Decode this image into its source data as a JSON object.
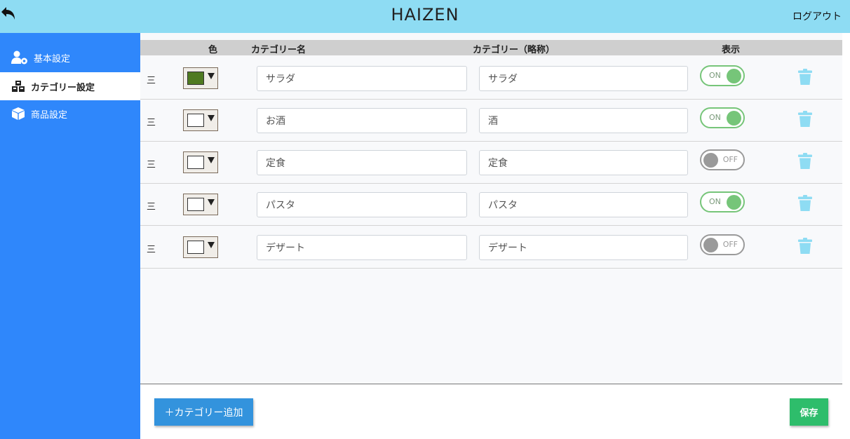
{
  "header": {
    "title": "HAIZEN",
    "logout_label": "ログアウト",
    "back_icon": "back-arrow-icon"
  },
  "sidebar": {
    "items": [
      {
        "label": "基本設定",
        "icon": "user-gear-icon",
        "active": false
      },
      {
        "label": "カテゴリー設定",
        "icon": "cubes-icon",
        "active": true
      },
      {
        "label": "商品設定",
        "icon": "box-icon",
        "active": false
      }
    ]
  },
  "table": {
    "headers": {
      "color": "色",
      "name": "カテゴリー名",
      "abbr": "カテゴリー（略称）",
      "display": "表示"
    },
    "rows": [
      {
        "handle": "三",
        "color": "#4f7a21",
        "name": "サラダ",
        "abbr": "サラダ",
        "display": "ON"
      },
      {
        "handle": "三",
        "color": "#ffffff",
        "name": "お酒",
        "abbr": "酒",
        "display": "ON"
      },
      {
        "handle": "三",
        "color": "#ffffff",
        "name": "定食",
        "abbr": "定食",
        "display": "OFF"
      },
      {
        "handle": "三",
        "color": "#ffffff",
        "name": "パスタ",
        "abbr": "パスタ",
        "display": "ON"
      },
      {
        "handle": "三",
        "color": "#ffffff",
        "name": "デザート",
        "abbr": "デザート",
        "display": "OFF"
      }
    ]
  },
  "footer": {
    "add_label": "＋カテゴリー追加",
    "save_label": "保存"
  },
  "colors": {
    "header_bg": "#8edcf3",
    "sidebar_bg": "#2f87fb",
    "toggle_on": "#76c579",
    "toggle_off": "#9a9a9a",
    "trash": "#8edcf3",
    "add_button": "#3393dd",
    "save_button": "#2ebd6b"
  }
}
